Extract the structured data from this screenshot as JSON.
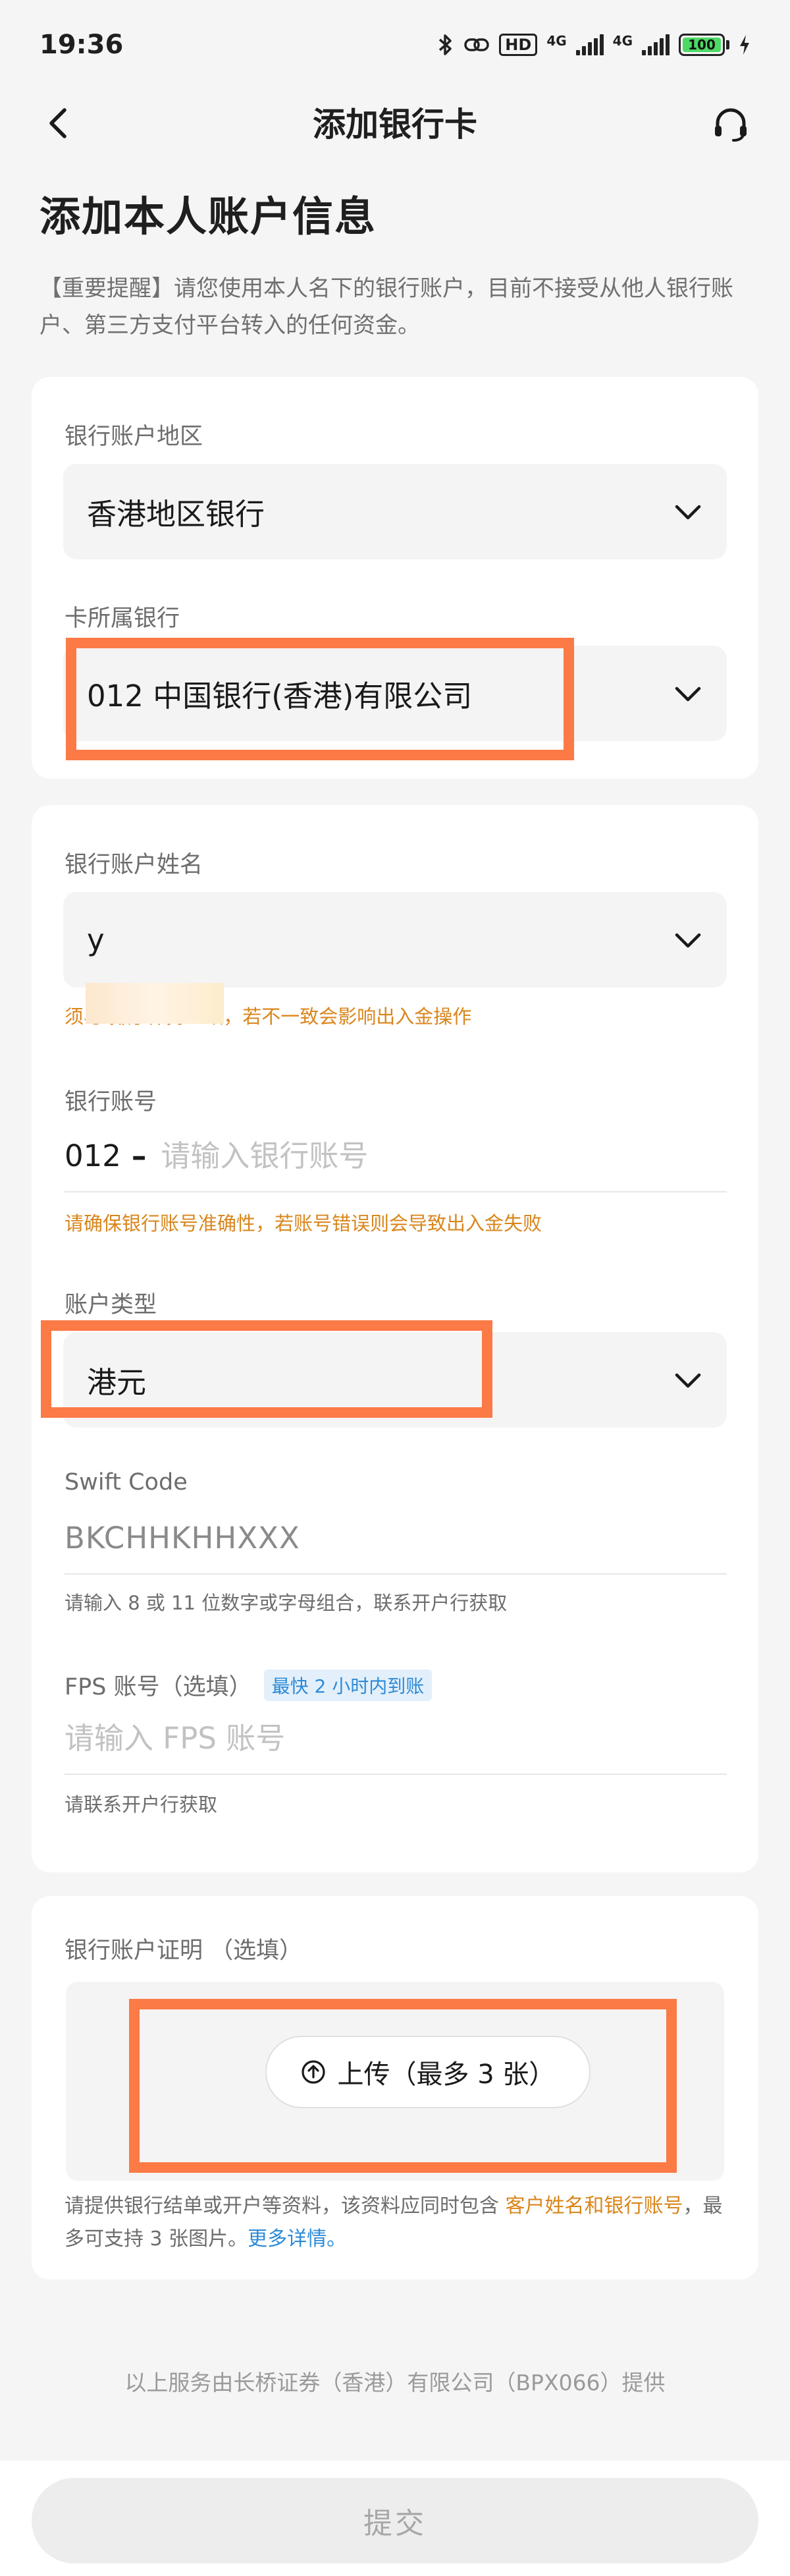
{
  "status_bar": {
    "time": "19:36",
    "network_labels": [
      "4G",
      "4G"
    ],
    "hd_label": "HD",
    "battery_level": "100",
    "icons": [
      "bluetooth-icon",
      "link-icon",
      "signal-icon",
      "battery-icon",
      "charging-icon"
    ]
  },
  "nav": {
    "title": "添加银行卡",
    "back_icon": "chevron-left-icon",
    "support_icon": "headset-icon"
  },
  "page": {
    "heading": "添加本人账户信息",
    "notice": "【重要提醒】请您使用本人名下的银行账户，目前不接受从他人银行账户、第三方支付平台转入的任何资金。"
  },
  "bank_region": {
    "label": "银行账户地区",
    "value": "香港地区银行"
  },
  "bank_name": {
    "label": "卡所属银行",
    "value": "012 中国银行(香港)有限公司"
  },
  "account_name": {
    "label": "银行账户姓名",
    "value": "y",
    "hint": "须与          排序保持一致，若不一致会影响出入金操作"
  },
  "account_number": {
    "label": "银行账号",
    "prefix": "012",
    "dash": "–",
    "placeholder": "请输入银行账号",
    "hint": "请确保银行账号准确性，若账号错误则会导致出入金失败"
  },
  "account_type": {
    "label": "账户类型",
    "value": "港元"
  },
  "swift": {
    "label": "Swift Code",
    "value": "BKCHHKHHXXX",
    "hint": "请输入 8 或 11 位数字或字母组合，联系开户行获取"
  },
  "fps": {
    "label": "FPS 账号（选填）",
    "tag": "最快 2 小时内到账",
    "placeholder": "请输入 FPS 账号",
    "hint": "请联系开户行获取"
  },
  "proof": {
    "label": "银行账户证明 （选填）",
    "upload_label": "上传（最多 3 张）",
    "desc_part1": "请提供银行结单或开户等资料，该资料应同时包含 ",
    "desc_highlight": "客户姓名和银行账号",
    "desc_part2": "，最多可支持 3 张图片。",
    "desc_link": "更多详情。"
  },
  "footer": {
    "note": "以上服务由长桥证券（香港）有限公司（BPX066）提供",
    "submit_label": "提交"
  },
  "colors": {
    "accent_warn": "#d9861c",
    "link": "#2d8ad6",
    "redaction": "#fb7a45"
  }
}
